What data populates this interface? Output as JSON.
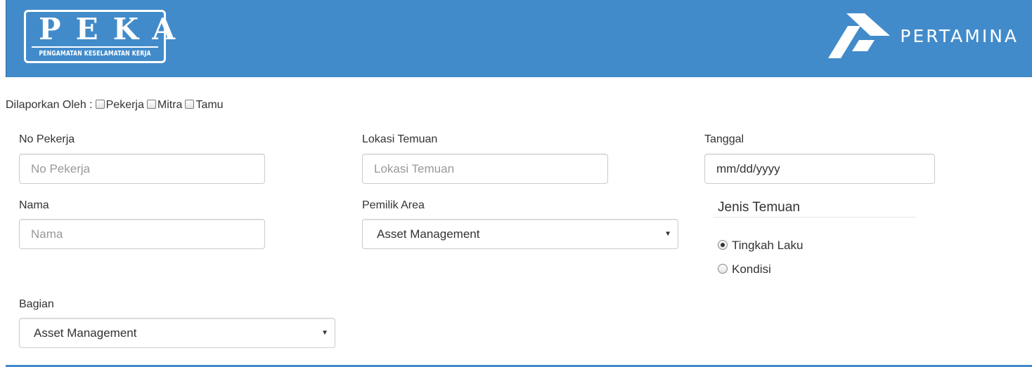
{
  "header": {
    "logo_title": "PEKA",
    "logo_subtitle": "PENGAMATAN KESELAMATAN KERJA",
    "brand_name": "PERTAMINA",
    "bg_color": "#428bca"
  },
  "reported_by": {
    "label": "Dilaporkan Oleh :",
    "options": [
      {
        "label": "Pekerja",
        "checked": false
      },
      {
        "label": "Mitra",
        "checked": false
      },
      {
        "label": "Tamu",
        "checked": false
      }
    ]
  },
  "form": {
    "no_pekerja": {
      "label": "No Pekerja",
      "placeholder": "No Pekerja",
      "value": ""
    },
    "nama": {
      "label": "Nama",
      "placeholder": "Nama",
      "value": ""
    },
    "bagian": {
      "label": "Bagian",
      "selected": "Asset Management"
    },
    "lokasi_temuan": {
      "label": "Lokasi Temuan",
      "placeholder": "Lokasi Temuan",
      "value": ""
    },
    "pemilik_area": {
      "label": "Pemilik Area",
      "selected": "Asset Management"
    },
    "tanggal": {
      "label": "Tanggal",
      "placeholder": "mm/dd/yyyy"
    },
    "jenis_temuan": {
      "title": "Jenis Temuan",
      "options": [
        {
          "label": "Tingkah Laku",
          "checked": true
        },
        {
          "label": "Kondisi",
          "checked": false
        }
      ]
    }
  },
  "icons": {
    "caret": "chevron-down-icon",
    "brand": "pertamina-logo-icon"
  }
}
